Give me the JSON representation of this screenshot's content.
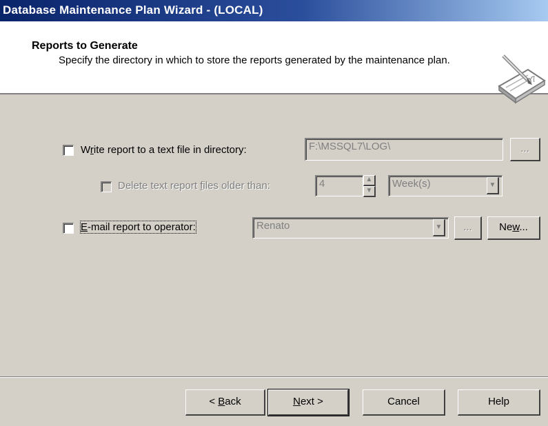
{
  "window": {
    "title": "Database Maintenance Plan Wizard - (LOCAL)"
  },
  "header": {
    "title": "Reports to Generate",
    "subtitle": "Specify the directory in which to store the reports generated by the maintenance plan."
  },
  "options": {
    "write_report": {
      "label_pre": "W",
      "label_mn": "r",
      "label_post": "ite report to a text file in directory:",
      "checked": false,
      "path": "F:\\MSSQL7\\LOG\\",
      "browse": "..."
    },
    "delete_files": {
      "label_pre": "Delete text report ",
      "label_mn": "f",
      "label_post": "iles older than:",
      "checked": false,
      "amount": "4",
      "unit": "Week(s)"
    },
    "email_report": {
      "label_pre": "",
      "label_mn": "E",
      "label_post": "-mail report to operator:",
      "checked": false,
      "operator": "Renato",
      "browse": "...",
      "new_pre": "Ne",
      "new_mn": "w",
      "new_post": "..."
    }
  },
  "footer": {
    "back_pre": "< ",
    "back_mn": "B",
    "back_post": "ack",
    "next_mn": "N",
    "next_post": "ext >",
    "cancel": "Cancel",
    "help": "Help"
  },
  "icons": {
    "header": "notepad-pencil-icon",
    "dropdown": "chevron-down-icon",
    "spin_up": "spin-up-icon",
    "spin_down": "spin-down-icon"
  }
}
